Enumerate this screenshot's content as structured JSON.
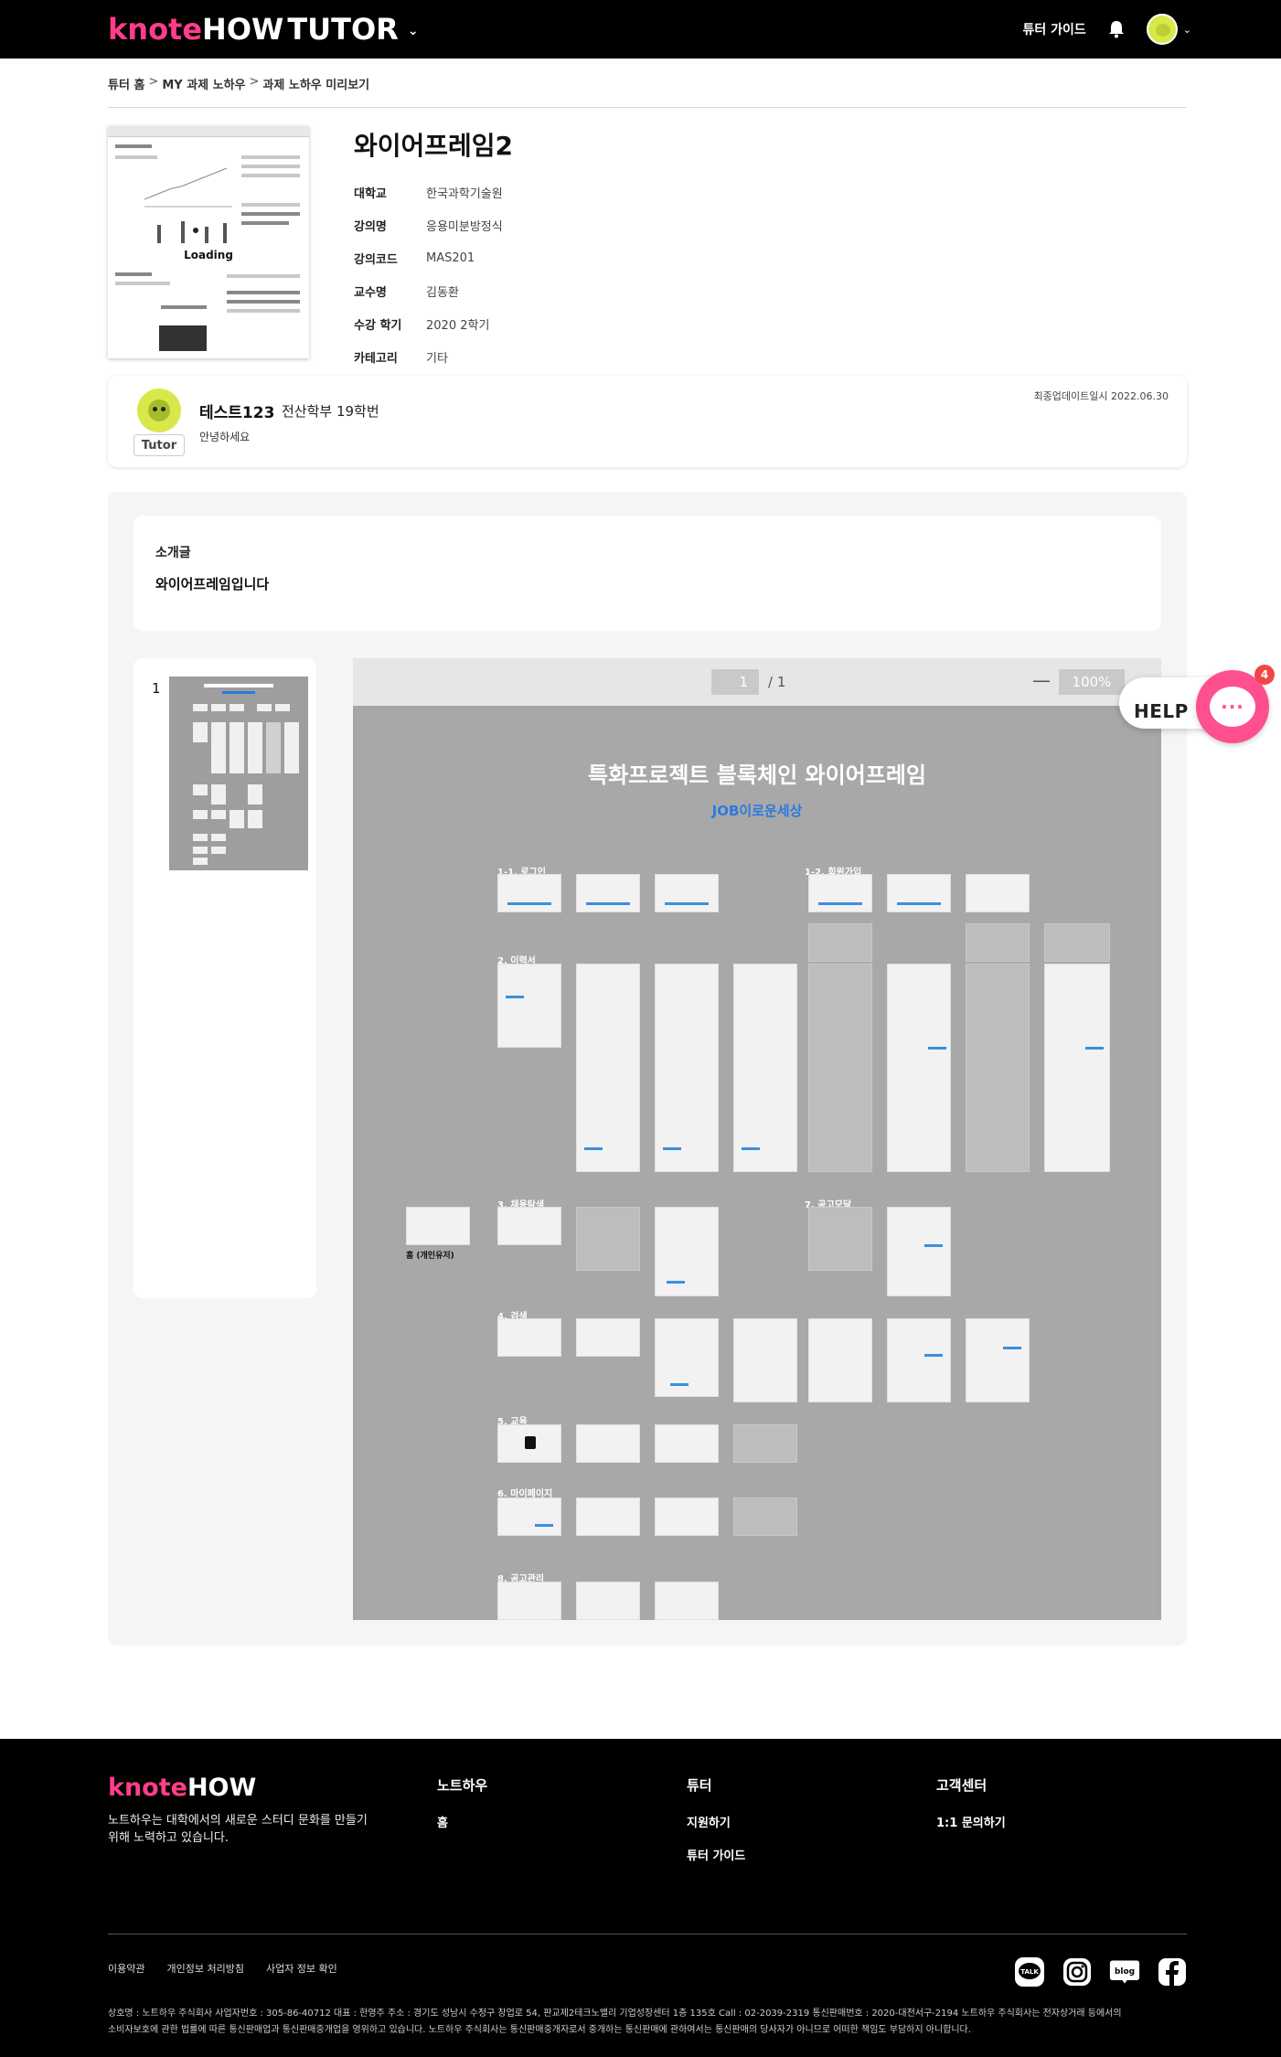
{
  "header": {
    "logo_note": "knote",
    "logo_how": "HOW",
    "logo_tutor": "TUTOR",
    "tutor_guide": "튜터 가이드",
    "icons": [
      "chevron-down-icon",
      "bell-icon",
      "avatar"
    ]
  },
  "breadcrumb": {
    "items": [
      "튜터 홈",
      "MY 과제 노하우",
      "과제 노하우 미리보기"
    ],
    "separator": ">"
  },
  "doc": {
    "thumb_loading": "Loading",
    "title": "와이어프레임2",
    "info": [
      {
        "key": "대학교",
        "value": "한국과학기술원"
      },
      {
        "key": "강의명",
        "value": "응용미분방정식"
      },
      {
        "key": "강의코드",
        "value": "MAS201"
      },
      {
        "key": "교수명",
        "value": "김동환"
      },
      {
        "key": "수강 학기",
        "value": "2020 2학기"
      },
      {
        "key": "카테고리",
        "value": "기타"
      }
    ]
  },
  "tutor": {
    "badge": "Tutor",
    "name": "테스트123",
    "dept": "전산학부 19학번",
    "greeting": "안녕하세요",
    "updated": "최종업데이트일시 2022.06.30"
  },
  "intro": {
    "title": "소개글",
    "body": "와이어프레임입니다"
  },
  "viewer": {
    "page_list_number": "1",
    "current_page": "1",
    "total_pages": "/ 1",
    "zoom_minus": "—",
    "zoom": "100%",
    "wf_title": "특화프로젝트 블록체인 와이어프레임",
    "wf_subtitle": "JOB이로운세상",
    "sections": [
      "1-1. 로그인",
      "1-2. 회원가입",
      "2. 이력서",
      "3. 채용탐색",
      "7. 공고모달",
      "4. 검색",
      "5. 교육",
      "6. 마이페이지",
      "8. 공고관리"
    ],
    "home_label": "홈 (개인유저)",
    "colors": {
      "accent": "#2b7ae0",
      "page_bg": "#a8a8a8"
    }
  },
  "help": {
    "label": "HELP",
    "badge": "4",
    "icon": "chat-bubble-icon"
  },
  "footer": {
    "logo_note": "knote",
    "logo_how": "HOW",
    "description": "노트하우는 대학에서의 새로운 스터디 문화를 만들기 위해 노력하고 있습니다.",
    "cols": [
      {
        "title": "노트하우",
        "items": [
          "홈"
        ]
      },
      {
        "title": "튜터",
        "items": [
          "지원하기",
          "튜터 가이드"
        ]
      },
      {
        "title": "고객센터",
        "items": [
          "1:1 문의하기"
        ]
      }
    ],
    "links": [
      "이용약관",
      "개인정보 처리방침",
      "사업자 정보 확인"
    ],
    "social": [
      "kakaotalk-icon",
      "instagram-icon",
      "blog-icon",
      "facebook-icon"
    ],
    "social_labels": {
      "talk": "TALK",
      "blog": "blog"
    },
    "legal_1": "상호명 : 노트하우 주식회사 사업자번호 : 305-86-40712 대표 : 한영주 주소 : 경기도 성남시 수정구 창업로 54, 판교제2테크노밸리 기업성장센터 1층 135호 Call : 02-2039-2319 통신판매번호 : 2020-대전서구-2194 노트하우 주식회사는 전자상거래 등에서의",
    "legal_2": "소비자보호에 관한 법률에 따른 통신판매업과 통신판매중개업을 영위하고 있습니다. 노트하우 주식회사는 통신판매중개자로서 중개하는 통신판매에 관하여서는 통신판매의 당사자가 아니므로 어떠한 책임도 부담하지 아니합니다.",
    "colors": {
      "brand_pink": "#ff3d8b",
      "help_pink": "#ff4f8f"
    }
  }
}
